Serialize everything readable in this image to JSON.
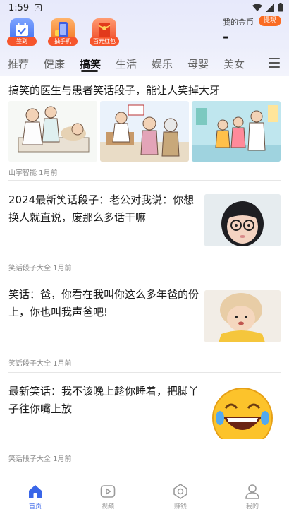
{
  "status_bar": {
    "time": "1:59",
    "notification_glyph": "A"
  },
  "header": {
    "promos": [
      {
        "label": "签到",
        "icon": "calendar-icon",
        "color": "#4a7cf0"
      },
      {
        "label": "抽手机",
        "icon": "phone-icon",
        "color": "#f07d2a"
      },
      {
        "label": "百元红包",
        "icon": "red-packet-icon",
        "color": "#ef5a2d"
      }
    ],
    "coins": {
      "label": "我的金币",
      "value": "-",
      "withdraw_label": "提现"
    }
  },
  "tabs": [
    "推荐",
    "健康",
    "搞笑",
    "生活",
    "娱乐",
    "母婴",
    "美女"
  ],
  "active_tab": "搞笑",
  "feed": [
    {
      "title": "搞笑的医生与患者笑话段子，能让人笑掉大牙",
      "meta": "山宇智能  1月前",
      "images": 3
    },
    {
      "title": "2024最新笑话段子：老公对我说：你想换人就直说，废那么多话干嘛",
      "meta": "笑话段子大全  1月前",
      "thumb": "girl-with-glasses"
    },
    {
      "title": "笑话：爸，你看在我叫你这么多年爸的份上，你也叫我声爸吧!",
      "meta": "笑话段子大全  1月前",
      "thumb": "toddler-in-hat"
    },
    {
      "title": "最新笑话：我不该晚上趁你睡着，把脚丫子往你嘴上放",
      "meta": "笑话段子大全  1月前",
      "thumb": "laughing-emoji"
    }
  ],
  "bottom_nav": [
    {
      "label": "首页",
      "icon": "home-icon",
      "active": true
    },
    {
      "label": "视频",
      "icon": "video-icon",
      "active": false
    },
    {
      "label": "赚钱",
      "icon": "earn-icon",
      "active": false
    },
    {
      "label": "我的",
      "icon": "profile-icon",
      "active": false
    }
  ],
  "colors": {
    "accent": "#3a66e8",
    "withdraw": "#fa6b22",
    "promo_tag": "#f6562c"
  }
}
